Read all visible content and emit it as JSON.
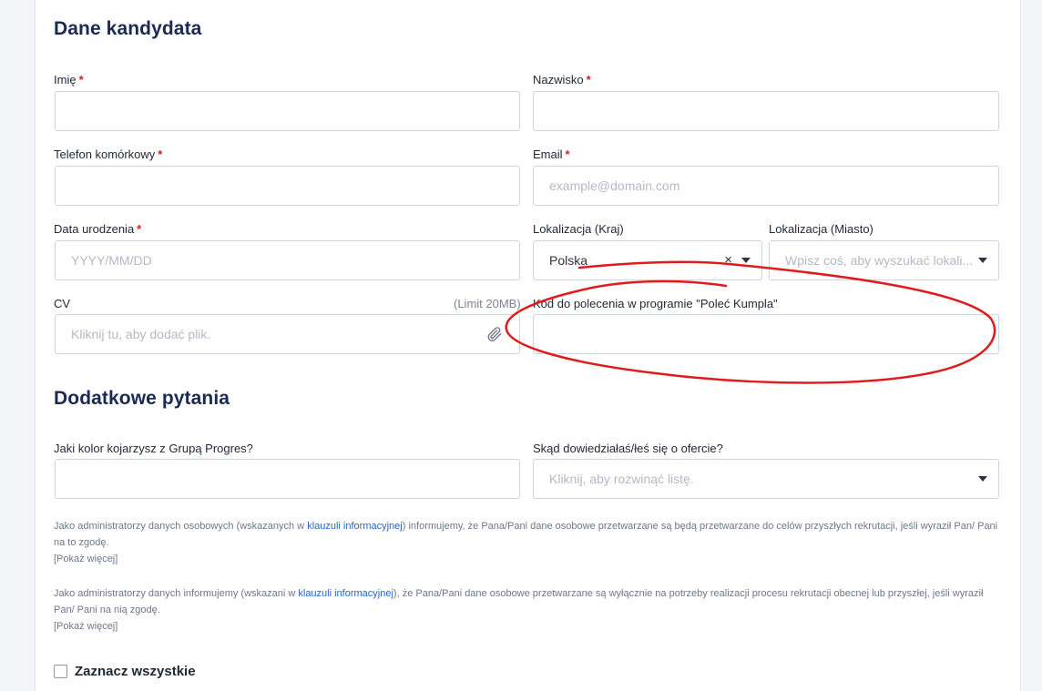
{
  "sections": {
    "candidate_title": "Dane kandydata",
    "extra_title": "Dodatkowe pytania"
  },
  "fields": {
    "first_name": {
      "label": "Imię",
      "required": "*",
      "value": ""
    },
    "last_name": {
      "label": "Nazwisko",
      "required": "*",
      "value": ""
    },
    "phone": {
      "label": "Telefon komórkowy",
      "required": "*",
      "value": ""
    },
    "email": {
      "label": "Email",
      "required": "*",
      "placeholder": "example@domain.com"
    },
    "birth_date": {
      "label": "Data urodzenia",
      "required": "*",
      "placeholder": "YYYY/MM/DD"
    },
    "country": {
      "label": "Lokalizacja (Kraj)",
      "value": "Polska",
      "clear": "×"
    },
    "city": {
      "label": "Lokalizacja (Miasto)",
      "placeholder": "Wpisz coś, aby wyszukać lokali..."
    },
    "cv": {
      "label": "CV",
      "limit": "(Limit 20MB)",
      "placeholder": "Kliknij tu, aby dodać plik."
    },
    "referral_code": {
      "label": "Kod do polecenia w programie \"Poleć Kumpla\"",
      "value": ""
    },
    "color_question": {
      "label": "Jaki kolor kojarzysz z Grupą Progres?",
      "value": ""
    },
    "source_question": {
      "label": "Skąd dowiedziałaś/łeś się o ofercie?",
      "placeholder": "Kliknij, aby rozwinąć listę."
    }
  },
  "consents": [
    {
      "before": "Jako administratorzy danych osobowych (wskazanych w ",
      "link": "klauzuli informacyjnej",
      "after": ") informujemy, że Pana/Pani dane osobowe przetwarzane są będą przetwarzane do celów przyszłych rekrutacji, jeśli wyraził Pan/ Pani na to zgodę.",
      "more": "[Pokaż więcej]"
    },
    {
      "before": "Jako administratorzy danych informujemy (wskazani w ",
      "link": "klauzuli informacyjnej",
      "after": "), że Pana/Pani dane osobowe przetwarzane są wyłącznie na potrzeby realizacji procesu rekrutacji obecnej lub przyszłej, jeśli wyraził Pan/ Pani na nią zgodę.",
      "more": "[Pokaż więcej]"
    }
  ],
  "select_all": {
    "label": "Zaznacz wszystkie",
    "checked": false
  },
  "colors": {
    "accent": "#1b2a52",
    "required": "#d42121",
    "link": "#2a64c5",
    "annotation": "#e01b1b"
  },
  "icons": [
    "paperclip-icon",
    "chevron-down-icon",
    "clear-icon"
  ]
}
